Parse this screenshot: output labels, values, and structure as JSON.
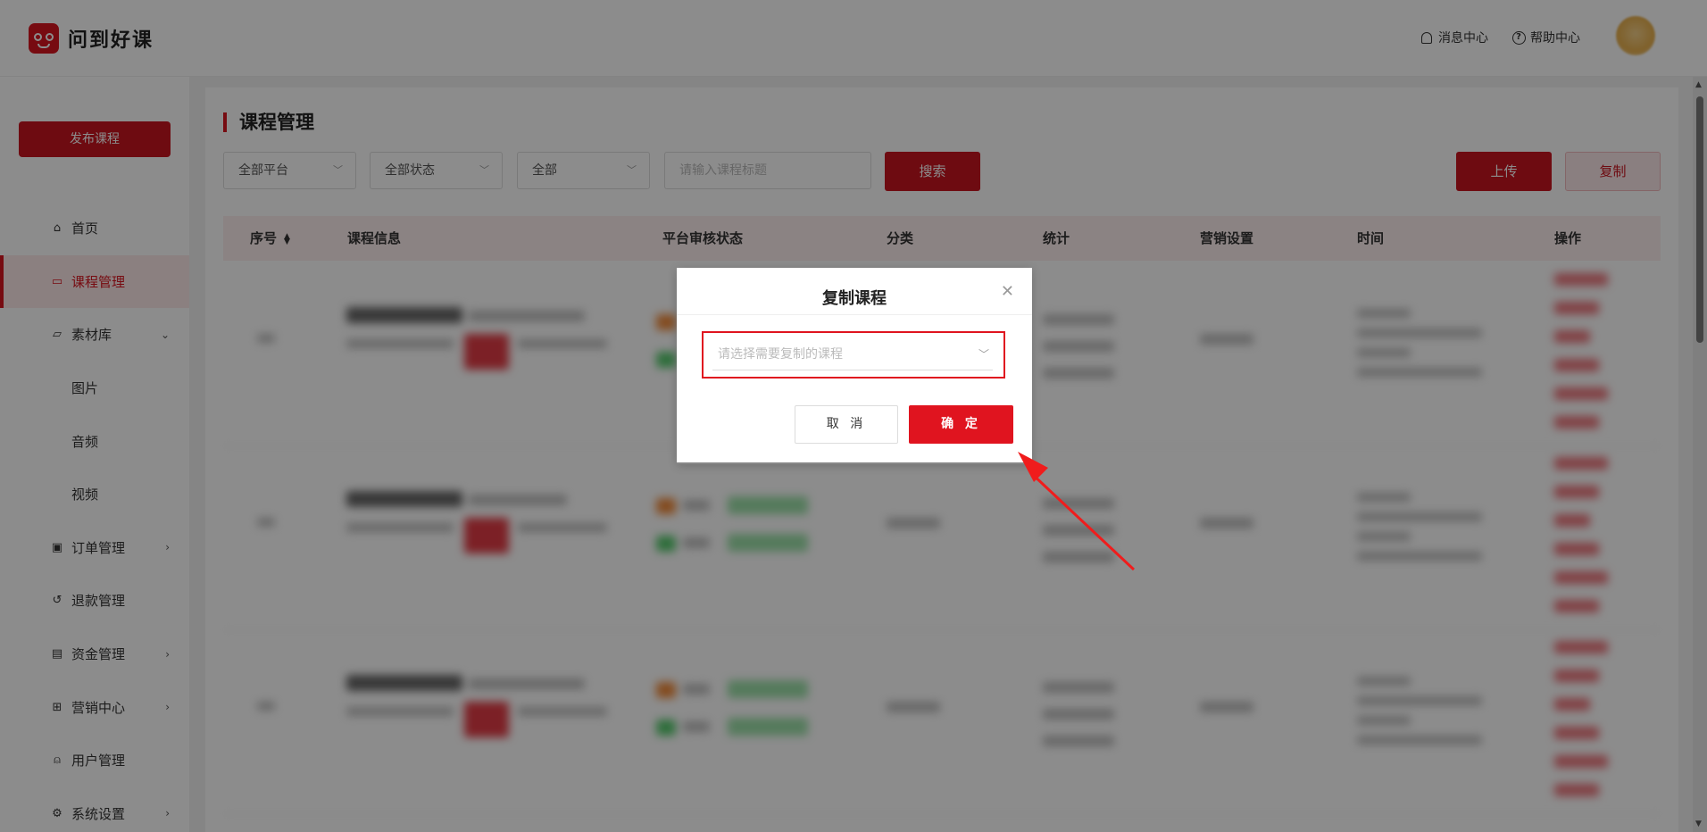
{
  "header": {
    "app_name": "问到好课",
    "messages": "消息中心",
    "help": "帮助中心"
  },
  "sidebar": {
    "publish": "发布课程",
    "items": [
      {
        "label": "首页",
        "icon": "home-icon"
      },
      {
        "label": "课程管理",
        "icon": "course-icon",
        "active": true
      },
      {
        "label": "素材库",
        "icon": "folder-icon",
        "expandable": "down"
      },
      {
        "label": "图片",
        "sub": true
      },
      {
        "label": "音频",
        "sub": true
      },
      {
        "label": "视频",
        "sub": true
      },
      {
        "label": "订单管理",
        "icon": "order-icon",
        "expandable": "right"
      },
      {
        "label": "退款管理",
        "icon": "refund-icon"
      },
      {
        "label": "资金管理",
        "icon": "wallet-icon",
        "expandable": "right"
      },
      {
        "label": "营销中心",
        "icon": "gift-icon",
        "expandable": "right"
      },
      {
        "label": "用户管理",
        "icon": "user-icon"
      },
      {
        "label": "系统设置",
        "icon": "gear-icon",
        "expandable": "right"
      }
    ]
  },
  "main": {
    "title": "课程管理",
    "filters": {
      "platform": "全部平台",
      "status": "全部状态",
      "all": "全部",
      "search_placeholder": "请输入课程标题"
    },
    "buttons": {
      "search": "搜索",
      "upload": "上传",
      "copy": "复制"
    },
    "table_headers": [
      "序号",
      "课程信息",
      "平台审核状态",
      "分类",
      "统计",
      "营销设置",
      "时间",
      "操作"
    ]
  },
  "dialog": {
    "title": "复制课程",
    "select_placeholder": "请选择需要复制的课程",
    "cancel": "取 消",
    "confirm": "确 定"
  },
  "colors": {
    "brand": "#c8141f",
    "highlight": "#e0141f",
    "arrow": "#f01c1c"
  }
}
